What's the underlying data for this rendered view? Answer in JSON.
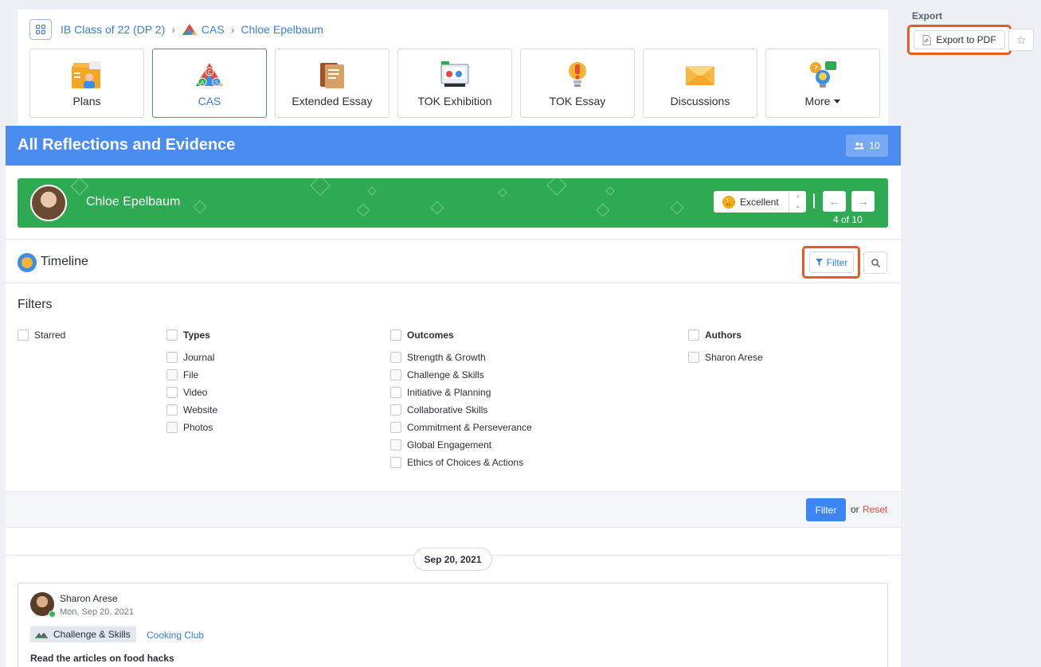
{
  "breadcrumb": {
    "items": [
      "IB Class of 22 (DP 2)",
      "CAS",
      "Chloe Epelbaum"
    ]
  },
  "tabs": [
    {
      "label": "Plans",
      "icon": "plans-icon"
    },
    {
      "label": "CAS",
      "icon": "cas-icon",
      "active": true
    },
    {
      "label": "Extended Essay",
      "icon": "extended-essay-icon"
    },
    {
      "label": "TOK Exhibition",
      "icon": "tok-exhibition-icon"
    },
    {
      "label": "TOK Essay",
      "icon": "tok-essay-icon"
    },
    {
      "label": "Discussions",
      "icon": "discussions-icon"
    },
    {
      "label": "More",
      "icon": "more-icon"
    }
  ],
  "export": {
    "label": "Export",
    "button": "Export to PDF"
  },
  "header": {
    "title": "All Reflections and Evidence",
    "count": "10"
  },
  "student": {
    "name": "Chloe Epelbaum",
    "grade": "Excellent",
    "pager": "4 of 10"
  },
  "timeline": {
    "title": "Timeline",
    "filter_label": "Filter"
  },
  "filters": {
    "title": "Filters",
    "starred": "Starred",
    "types": {
      "heading": "Types",
      "items": [
        "Journal",
        "File",
        "Video",
        "Website",
        "Photos"
      ]
    },
    "outcomes": {
      "heading": "Outcomes",
      "items": [
        "Strength & Growth",
        "Challenge & Skills",
        "Initiative & Planning",
        "Collaborative Skills",
        "Commitment & Perseverance",
        "Global Engagement",
        "Ethics of Choices & Actions"
      ]
    },
    "authors": {
      "heading": "Authors",
      "items": [
        "Sharon Arese"
      ]
    },
    "apply": "Filter",
    "or": "or",
    "reset": "Reset"
  },
  "date_divider": "Sep 20, 2021",
  "post": {
    "author": "Sharon Arese",
    "date": "Mon, Sep 20, 2021",
    "outcome": "Challenge & Skills",
    "activity": "Cooking Club",
    "title": "Read the articles on food hacks"
  },
  "colors": {
    "brand_blue": "#4a8cf0",
    "student_green": "#2eab52",
    "highlight_orange": "#ec5a24",
    "link_blue": "#3b7ddd",
    "reset_red": "#e0483e"
  }
}
